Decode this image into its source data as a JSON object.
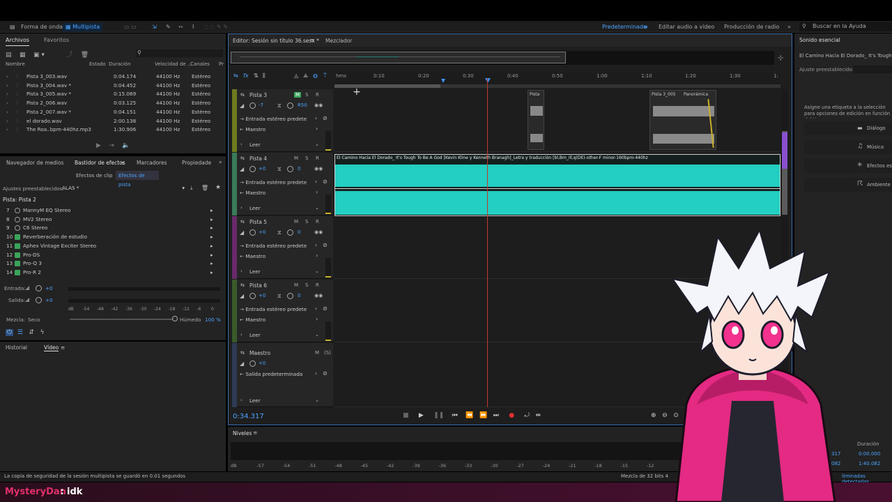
{
  "workspace": {
    "waveform_label": "Forma de onda",
    "multitrack_label": "Multipista",
    "preset_default": "Predeterminado",
    "edit_video": "Editar audio a vídeo",
    "radio": "Producción de radio",
    "search_placeholder": "Buscar en la Ayuda"
  },
  "files_panel": {
    "tab_files": "Archivos",
    "tab_favorites": "Favoritos",
    "columns": [
      "Nombre",
      "Estado",
      "Duración",
      "Velocidad de ...",
      "Canales",
      "Pr"
    ],
    "rows": [
      {
        "name": "Pista 3_003.wav",
        "duration": "0:04.174",
        "rate": "44100 Hz",
        "channels": "Estéreo"
      },
      {
        "name": "Pista 3_004.wav *",
        "duration": "0:04.452",
        "rate": "44100 Hz",
        "channels": "Estéreo"
      },
      {
        "name": "Pista 3_005.wav *",
        "duration": "0:15.069",
        "rate": "44100 Hz",
        "channels": "Estéreo"
      },
      {
        "name": "Pista 2_006.wav",
        "duration": "0:03.125",
        "rate": "44100 Hz",
        "channels": "Estéreo"
      },
      {
        "name": "Pista 2_007.wav *",
        "duration": "0:04.151",
        "rate": "44100 Hz",
        "channels": "Estéreo"
      },
      {
        "name": "el dorado.wav",
        "duration": "2:00.138",
        "rate": "44100 Hz",
        "channels": "Estéreo"
      },
      {
        "name": "The Roa..bpm-440hz.mp3",
        "duration": "1:30.906",
        "rate": "44100 Hz",
        "channels": "Estéreo"
      }
    ]
  },
  "effects_panel": {
    "tabs": [
      "Navegador de medios",
      "Bastidor de efectos",
      "Marcadores",
      "Propiedade"
    ],
    "subtabs": [
      "Efectos de clip",
      "Efectos de pista"
    ],
    "presets_label": "Ajustes preestablecidos:",
    "preset_value": "ALAS *",
    "track_label": "Pista: Pista 2",
    "effects": [
      {
        "num": "7",
        "name": "MannyM EQ Stereo"
      },
      {
        "num": "8",
        "name": "MV2 Stereo"
      },
      {
        "num": "9",
        "name": "C6 Stereo"
      },
      {
        "num": "10",
        "name": "Reverberación de estudio"
      },
      {
        "num": "11",
        "name": "Aphex Vintage Exciter Stereo"
      },
      {
        "num": "12",
        "name": "Pro-DS"
      },
      {
        "num": "13",
        "name": "Pro-Q 3"
      },
      {
        "num": "14",
        "name": "Pro-R 2"
      }
    ],
    "input_label": "Entrada:",
    "output_label": "Salida:",
    "gain_value": "+0",
    "meter_ticks": [
      "dB",
      "-54",
      "-48",
      "-42",
      "-36",
      "-30",
      "-24",
      "-18",
      "-12",
      "-6",
      "0"
    ],
    "mix_label": "Mezcla:",
    "dry_label": "Seco",
    "wet_label": "Húmedo",
    "wet_value": "100 %"
  },
  "history_panel": {
    "tab_history": "Historial",
    "tab_video": "Vídeo"
  },
  "editor": {
    "title": "Editor: Sesión sin título 36.sesx *",
    "mixer_tab": "Mezclador",
    "time_ruler": [
      "hms",
      "0:10",
      "0:20",
      "0:30",
      "0:40",
      "0:50",
      "1:00",
      "1:10",
      "1:20",
      "1:30",
      "1:"
    ],
    "current_time": "0:34.317",
    "tracks": [
      {
        "name": "Pista 3",
        "vol": "-7",
        "pan": "R50",
        "input": "Entrada estéreo predete",
        "output": "Maestro",
        "mode": "Leer"
      },
      {
        "name": "Pista 4",
        "vol": "+0",
        "pan": "0",
        "input": "Entrada estéreo predete",
        "output": "Maestro",
        "mode": "Leer"
      },
      {
        "name": "Pista 5",
        "vol": "+0",
        "pan": "0",
        "input": "Entrada estéreo predete",
        "output": "Maestro",
        "mode": "Leer"
      },
      {
        "name": "Pista 6",
        "vol": "+0",
        "pan": "0",
        "input": "Entrada estéreo predete",
        "output": "Maestro",
        "mode": "Leer"
      }
    ],
    "master": {
      "name": "Maestro",
      "vol": "+0",
      "output": "Salida predeterminada",
      "mode": "Leer"
    },
    "clips": {
      "small_clip": "Pista",
      "clip_005": "Pista 3_005",
      "panoramica": "Panorámica",
      "main_clip": "El Camino Hacia El Dorado_ It's Tough To Be A God [Kevin Kline y Kenneth Branagh]_Letra y traducción [bl,Bm_ill,q(DE)-other-F minor-160bpm-440hz"
    }
  },
  "levels": {
    "title": "Niveles",
    "ticks": [
      "dB",
      "-57",
      "-54",
      "-51",
      "-48",
      "-45",
      "-42",
      "-39",
      "-36",
      "-33",
      "-30",
      "-27",
      "-24",
      "-21",
      "-18",
      "-15",
      "-12"
    ]
  },
  "essential_sound": {
    "title": "Sonido esencial",
    "clip_name": "El Camino Hacia El Dorado_ It's Tough T",
    "preset_label": "Ajuste preestablecido:",
    "hint": "Asigne una etiqueta a la selección para opciones de edición en función del tipo",
    "buttons": [
      "Diálogo",
      "Música",
      "Efectos esp",
      "Ambiente"
    ],
    "duration_label": "Duración",
    "duration_1": "0:00.000",
    "duration_2": "1:40.082",
    "partial_1": "317",
    "partial_2": "082"
  },
  "status": {
    "message": "La copia de seguridad de la sesión multipista se guardó en 0.01 segundos",
    "mix_info": "Mezcla de 32 bits 4",
    "dropped": "liminadas detectadas"
  },
  "chat": {
    "user": "MysteryDan",
    "separator": " : ",
    "message": "idk"
  }
}
